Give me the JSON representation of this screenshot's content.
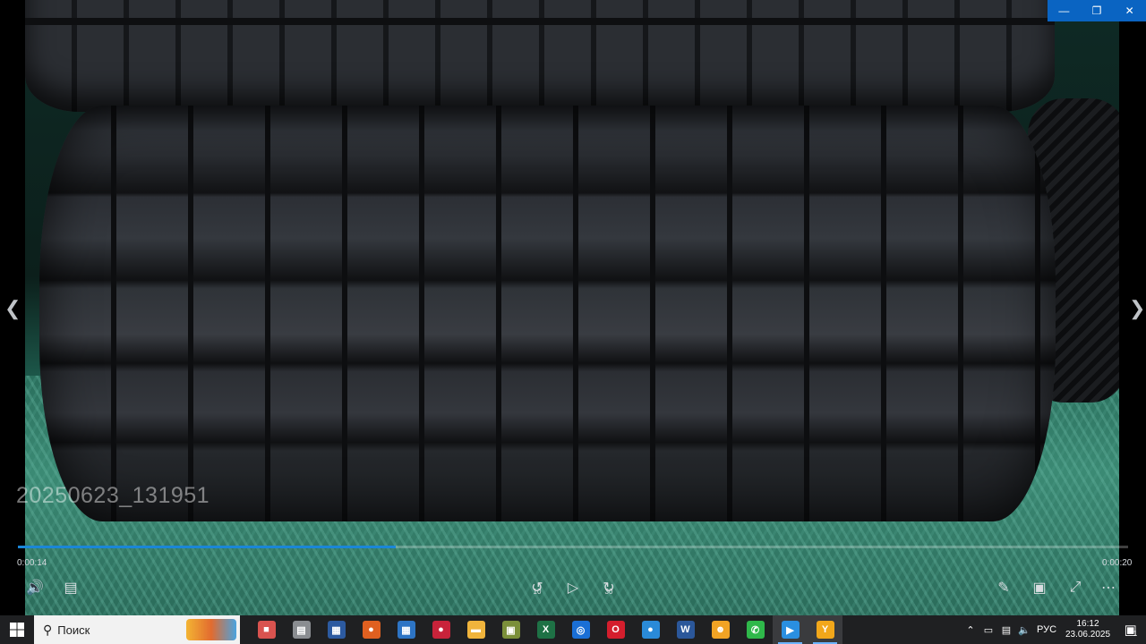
{
  "player": {
    "video_title": "20250623_131951",
    "current_time": "0:00:14",
    "total_time": "0:00:20",
    "progress_fraction": 0.34,
    "skip_back_seconds": "10",
    "skip_forward_seconds": "30",
    "accent_color": "#1a86d8"
  },
  "window": {
    "minimize_icon": "minimize-icon",
    "restore_icon": "restore-icon",
    "close_icon": "close-icon"
  },
  "taskbar": {
    "search_placeholder": "Поиск",
    "apps": [
      {
        "name": "fan-app",
        "icon": "■",
        "color": "#d9534f"
      },
      {
        "name": "file-app",
        "icon": "▤",
        "color": "#8a8d91"
      },
      {
        "name": "monitor-app",
        "icon": "▦",
        "color": "#2c5aa0"
      },
      {
        "name": "fire-app",
        "icon": "●",
        "color": "#e06020"
      },
      {
        "name": "calculator-app",
        "icon": "▦",
        "color": "#2d74c4"
      },
      {
        "name": "record-app",
        "icon": "●",
        "color": "#c8233a"
      },
      {
        "name": "explorer-app",
        "icon": "▬",
        "color": "#f0b43c"
      },
      {
        "name": "photos-app",
        "icon": "▣",
        "color": "#7b8f3a"
      },
      {
        "name": "excel-app",
        "icon": "X",
        "color": "#1e7145"
      },
      {
        "name": "cleaner-app",
        "icon": "◎",
        "color": "#1a6fd6"
      },
      {
        "name": "opera-app",
        "icon": "O",
        "color": "#d41e2d"
      },
      {
        "name": "paint-app",
        "icon": "●",
        "color": "#2a8ad8"
      },
      {
        "name": "word-app",
        "icon": "W",
        "color": "#2b579a"
      },
      {
        "name": "media-app",
        "icon": "☻",
        "color": "#f1a324"
      },
      {
        "name": "phone-app",
        "icon": "✆",
        "color": "#2fb84a"
      },
      {
        "name": "video-player-app",
        "icon": "▶",
        "color": "#2a8fe0",
        "active": true
      },
      {
        "name": "yandex-app",
        "icon": "Y",
        "color": "#f2a71a",
        "active": true
      }
    ],
    "language": "РУС",
    "time": "16:12",
    "date": "23.06.2025",
    "notification_count": "1"
  }
}
